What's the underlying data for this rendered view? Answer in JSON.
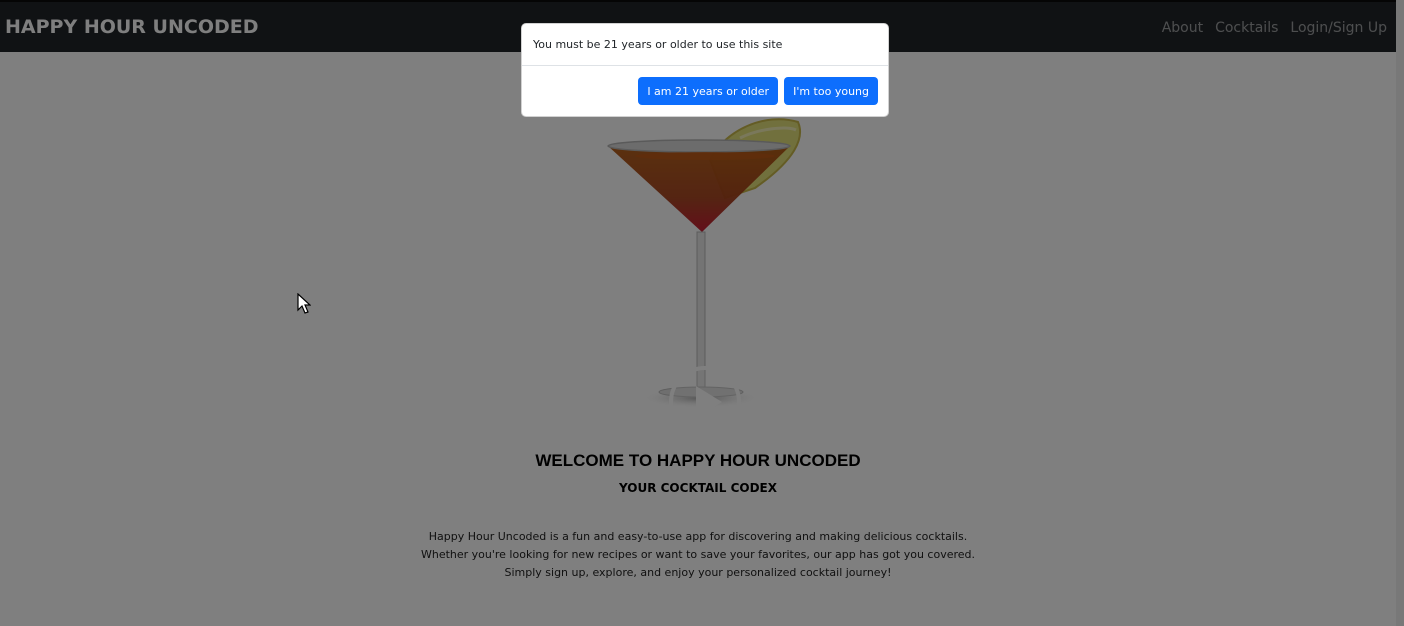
{
  "navbar": {
    "brand": "HAPPY HOUR UNCODED",
    "links": [
      "About",
      "Cocktails",
      "Login/Sign Up"
    ]
  },
  "hero": {
    "video_controls": {
      "play_icon": "play-icon"
    }
  },
  "welcome": {
    "title": "WELCOME TO HAPPY HOUR UNCODED",
    "subtitle": "YOUR COCKTAIL CODEX",
    "description_lines": [
      "Happy Hour Uncoded is a fun and easy-to-use app for discovering and making delicious cocktails.",
      "Whether you're looking for new recipes or want to save your favorites, our app has got you covered.",
      "Simply sign up, explore, and enjoy your personalized cocktail journey!"
    ]
  },
  "age_modal": {
    "message": "You must be 21 years or older to use this site",
    "confirm_label": "I am 21 years or older",
    "deny_label": "I'm too young"
  },
  "colors": {
    "navbar_bg": "#212529",
    "primary_button": "#0d6efd",
    "backdrop": "rgba(0,0,0,0.5)"
  }
}
